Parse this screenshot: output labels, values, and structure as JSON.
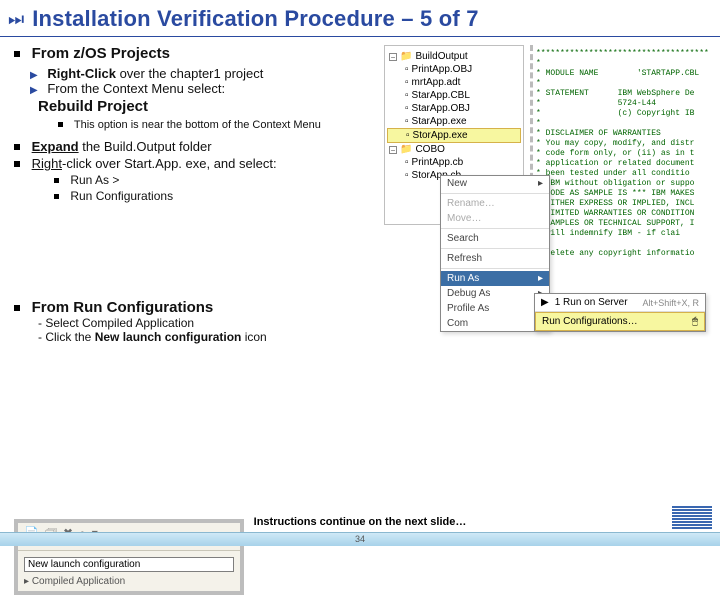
{
  "title": "Installation Verification Procedure – 5 of 7",
  "sec1": {
    "heading": "From z/OS Projects",
    "b1_prefix": "Right-Click",
    "b1_rest": " over the chapter1 project",
    "b2": "From the Context Menu select:",
    "rebuild": "Rebuild Project",
    "note": "This option is near the bottom of the Context Menu"
  },
  "sec2": {
    "l1a": "Expand",
    "l1b": " the Build.Output folder",
    "l2a": "Right",
    "l2b": "-click over Start.App. exe, and select:",
    "sub1": "Run As       >",
    "sub2": "Run Configurations"
  },
  "sec3": {
    "heading": "From Run Configurations",
    "d1": "- Select Compiled Application",
    "d2a": "- Click the ",
    "d2b": "New launch configuration",
    "d2c": " icon"
  },
  "footer": {
    "instr": "Instructions continue on the next slide…",
    "page": "34"
  },
  "tree": {
    "t0": "BuildOutput",
    "t1": "PrintApp.OBJ",
    "t2": "mrtApp.adt",
    "t3": "StarApp.CBL",
    "t4": "StarApp.OBJ",
    "t5": "StarApp.exe",
    "sel": "StorApp.exe",
    "t6": "COBO",
    "t7": "PrintApp.cb",
    "t8": "StorApp.cb"
  },
  "ctx": {
    "new": "New",
    "rename": "Rename…",
    "move": "Move…",
    "search": "Search",
    "refresh": "Refresh",
    "runas": "Run As",
    "debugas": "Debug As",
    "profileas": "Profile As",
    "com": "Com"
  },
  "fly": {
    "r1": "1 Run on Server",
    "r1k": "Alt+Shift+X, R",
    "r2": "Run Configurations…"
  },
  "toolbar": {
    "placeholder": "New launch configuration",
    "label": "Compiled Application"
  },
  "code_text": "************************************\n*\n* MODULE NAME        'STARTAPP.CBL\n*\n* STATEMENT      IBM WebSphere De\n*                5724-L44\n*                (c) Copyright IB\n*\n* DISCLAIMER OF WARRANTIES\n* You may copy, modify, and distr\n* code form only, or (ii) as in t\n* application or related document\n* been tested under all conditio\n* IBM without obligation or suppo\n* CODE AS SAMPLE IS *** IBM MAKES\n* EITHER EXPRESS OR IMPLIED, INCL\n* LIMITED WARRANTIES OR CONDITION\n* SAMPLES OR TECHNICAL SUPPORT, I\n* will indemnify IBM - if clai\n*\n* delete any copyright informatio"
}
